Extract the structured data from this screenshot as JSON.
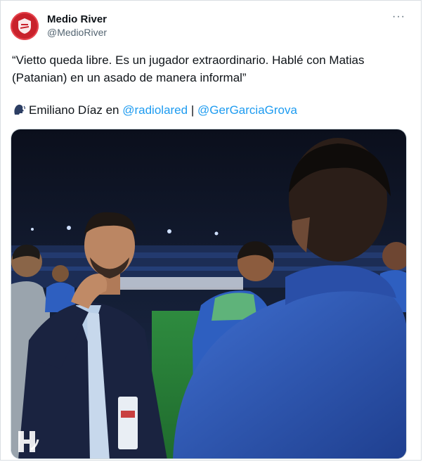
{
  "author": {
    "display_name": "Medio River",
    "handle": "@MedioRiver",
    "avatar_icon": "club-crest-icon",
    "avatar_color": "#c8212b"
  },
  "menu": {
    "more_label": "···",
    "more_icon": "more-options-icon"
  },
  "tweet": {
    "text": "“Vietto queda libre. Es un jugador extraordinario. Hablé con Matias (Patanian) en un asado de manera informal”",
    "credit_emoji_icon": "speaking-head-icon",
    "credit_prefix": "Emiliano Díaz en ",
    "mention_1": "@radiolared",
    "separator": " | ",
    "mention_2": "@GerGarciaGrova"
  },
  "media": {
    "type": "photo",
    "watermark_icon": "al-hilal-logo-icon"
  },
  "colors": {
    "link": "#1d9bf0",
    "text": "#0f1419",
    "secondary": "#536471"
  }
}
